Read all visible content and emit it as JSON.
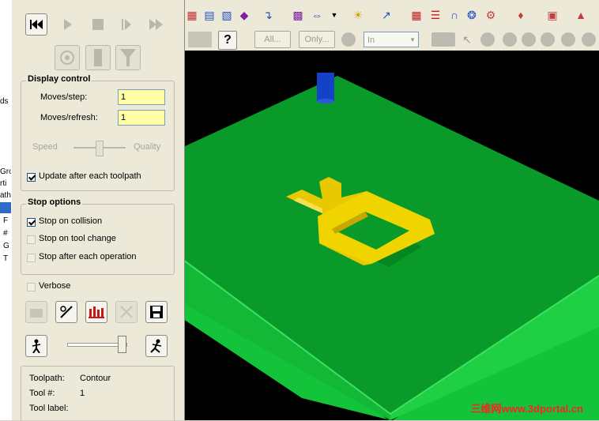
{
  "dialog": {
    "display_control": {
      "title": "Display control",
      "moves_step_label": "Moves/step:",
      "moves_step_value": "1",
      "moves_refresh_label": "Moves/refresh:",
      "moves_refresh_value": "1",
      "speed_label": "Speed",
      "quality_label": "Quality",
      "update_label": "Update after each toolpath",
      "update_checked": true
    },
    "stop_options": {
      "title": "Stop options",
      "collision_label": "Stop on collision",
      "tool_change_label": "Stop on tool change",
      "after_op_label": "Stop after each operation"
    },
    "verbose_label": "Verbose",
    "info": {
      "toolpath_label": "Toolpath:",
      "toolpath_value": "Contour",
      "tool_no_label": "Tool #:",
      "tool_no_value": "1",
      "tool_label_label": "Tool label:"
    }
  },
  "toolbar2": {
    "all_button": "All...",
    "only_button": "Only...",
    "in_select": "In",
    "help_glyph": "?"
  },
  "left_strip": [
    "ds",
    "Gro",
    "rti",
    "ath",
    "F",
    "#",
    "G",
    "T"
  ],
  "watermark": "三维网www.3dportal.cn",
  "colors": {
    "board_top": "#0a9a2a",
    "board_side": "#13c33a",
    "board_edge": "#2fd14d",
    "pocket": "#e8c800",
    "tool": "#1540c8",
    "field_bg": "#ffffa8",
    "watermark": "#ff2020"
  }
}
